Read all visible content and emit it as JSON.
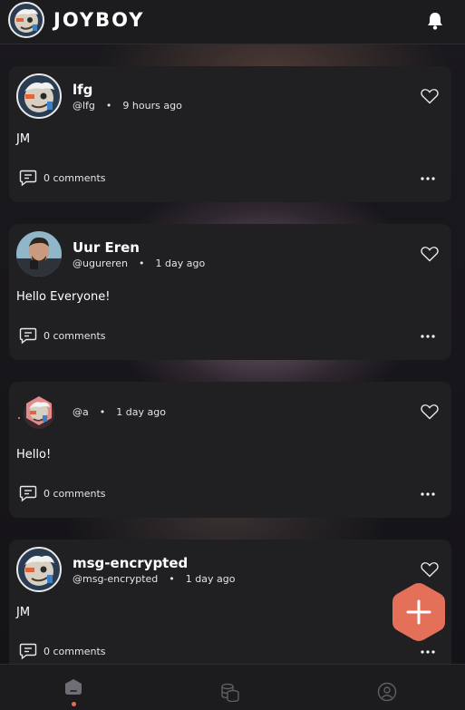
{
  "app": {
    "brand": "JOYBOY"
  },
  "colors": {
    "accent": "#e4705a",
    "card": "#202023",
    "background": "#17161a"
  },
  "header": {
    "icons": [
      "avatar-logo",
      "bell-icon"
    ]
  },
  "posts": [
    {
      "name": "lfg",
      "handle": "@lfg",
      "time": "9 hours ago",
      "text": "JM",
      "comments": "0 comments"
    },
    {
      "name": "Uur Eren",
      "handle": "@ugureren",
      "time": "1 day ago",
      "text": "Hello Everyone!",
      "comments": "0 comments"
    },
    {
      "name": "",
      "handle": "@a",
      "time": "1 day ago",
      "text": "Hello!",
      "comments": "0 comments"
    },
    {
      "name": "msg-encrypted",
      "handle": "@msg-encrypted",
      "time": "1 day ago",
      "text": "JM",
      "comments": "0 comments"
    }
  ],
  "meta_separator": "•",
  "bottom_nav": {
    "items": [
      "home",
      "wallet",
      "profile"
    ],
    "active": "home"
  }
}
